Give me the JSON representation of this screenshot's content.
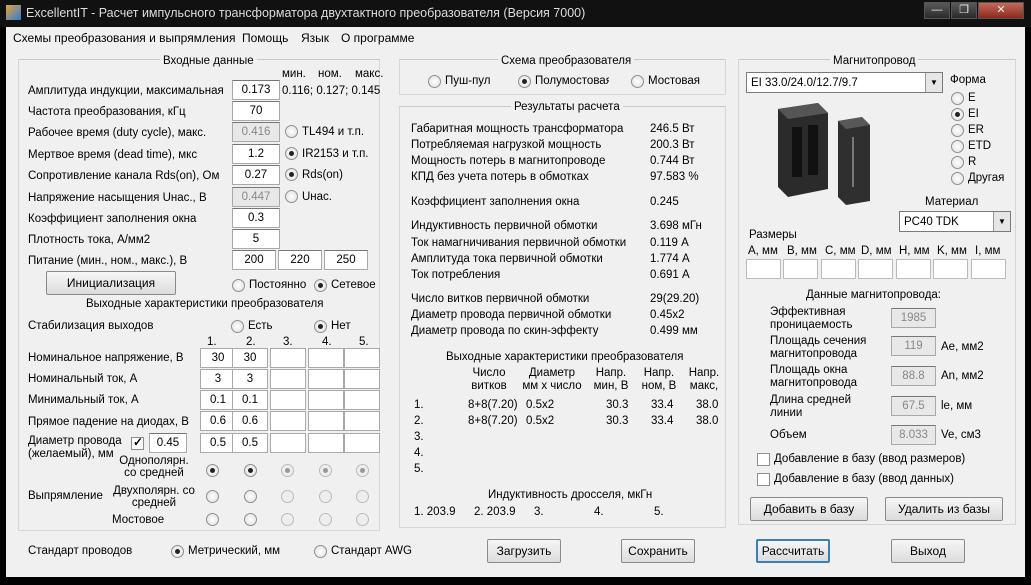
{
  "window": {
    "title": "ExcellentIT - Расчет импульсного трансформатора двухтактного преобразователя (Версия 7000)",
    "min": "—",
    "max": "❐",
    "close": "✕"
  },
  "menu": [
    "Схемы преобразования и выпрямления",
    "Помощь",
    "Язык",
    "О программе"
  ],
  "input": {
    "title": "Входные данные",
    "col_min": "мин.",
    "col_nom": "ном.",
    "col_max": "макс.",
    "induction_label": "Амплитуда индукции, максимальная",
    "induction_value": "0.173",
    "induction_hint": "0.116; 0.127; 0.145",
    "freq_label": "Частота преобразования, кГц",
    "freq_value": "70",
    "duty_label": "Рабочее время (duty cycle), макс.",
    "duty_value": "0.416",
    "duty_opt": "TL494 и т.п.",
    "dead_label": "Мертвое время (dead time), мкс",
    "dead_value": "1.2",
    "dead_opt": "IR2153 и т.п.",
    "rds_label": "Сопротивление канала Rds(on), Ом",
    "rds_value": "0.27",
    "rds_opt": "Rds(on)",
    "usat_label": "Напряжение насыщения Uнас., В",
    "usat_value": "0.447",
    "usat_opt": "Uнас.",
    "fill_label": "Коэффициент заполнения окна",
    "fill_value": "0.3",
    "density_label": "Плотность тока, А/мм2",
    "density_value": "5",
    "supply_label": "Питание (мин., ном., макс.), В",
    "supply_min": "200",
    "supply_nom": "220",
    "supply_max": "250",
    "init_button": "Инициализация",
    "const_label": "Постоянно",
    "mains_label": "Сетевое"
  },
  "outputs": {
    "title": "Выходные характеристики преобразователя",
    "stab_label": "Стабилизация выходов",
    "yes": "Есть",
    "no": "Нет",
    "cols": [
      "1.",
      "2.",
      "3.",
      "4.",
      "5."
    ],
    "vnom_label": "Номинальное напряжение, В",
    "vnom": [
      "30",
      "30",
      "",
      "",
      ""
    ],
    "inom_label": "Номинальный ток, А",
    "inom": [
      "3",
      "3",
      "",
      "",
      ""
    ],
    "imin_label": "Минимальный ток, А",
    "imin": [
      "0.1",
      "0.1",
      "",
      "",
      ""
    ],
    "vdiode_label": "Прямое падение на диодах, В",
    "vdiode": [
      "0.6",
      "0.6",
      "",
      "",
      ""
    ],
    "wire_label": "Диаметр провода (желаемый), мм",
    "wire_default": "0.45",
    "wire": [
      "0.5",
      "0.5",
      "",
      "",
      ""
    ],
    "rect_label": "Выпрямление",
    "rect_opts": [
      "Однополярн. со средней",
      "Двухполярн. со средней",
      "Мостовое"
    ]
  },
  "wire_std": {
    "label": "Стандарт проводов",
    "metric": "Метрический, мм",
    "awg": "Стандарт AWG"
  },
  "scheme": {
    "title": "Схема преобразователя",
    "opts": [
      "Пуш-пул",
      "Полумостовая",
      "Мостовая"
    ]
  },
  "results": {
    "title": "Результаты расчета",
    "rows": [
      [
        "Габаритная мощность трансформатора",
        "246.5 Вт"
      ],
      [
        "Потребляемая нагрузкой мощность",
        "200.3 Вт"
      ],
      [
        "Мощность потерь в магнитопроводе",
        "0.744 Вт"
      ],
      [
        "КПД без учета потерь в обмотках",
        "97.583 %"
      ],
      [
        "Коэффициент заполнения окна",
        "0.245"
      ],
      [
        "Индуктивность первичной обмотки",
        "3.698 мГн"
      ],
      [
        "Ток намагничивания первичной обмотки",
        "0.119 А"
      ],
      [
        "Амплитуда тока первичной обмотки",
        "1.774 А"
      ],
      [
        "Ток потребления",
        "0.691 А"
      ],
      [
        "Число витков первичной обмотки",
        "29(29.20)"
      ],
      [
        "Диаметр провода первичной обмотки",
        "0.45x2"
      ],
      [
        "Диаметр провода по скин-эффекту",
        "0.499 мм"
      ]
    ],
    "out_title": "Выходные характеристики преобразователя",
    "h_turns": "Число витков",
    "h_diam": "Диаметр мм х число",
    "h_vmin": "Напр. мин, В",
    "h_vnom": "Напр. ном, В",
    "h_vmax": "Напр. макс,",
    "out_rows": [
      [
        "1.",
        "8+8(7.20)",
        "0.5x2",
        "30.3",
        "33.4",
        "38.0"
      ],
      [
        "2.",
        "8+8(7.20)",
        "0.5x2",
        "30.3",
        "33.4",
        "38.0"
      ],
      [
        "3.",
        "",
        "",
        "",
        "",
        ""
      ],
      [
        "4.",
        "",
        "",
        "",
        "",
        ""
      ],
      [
        "5.",
        "",
        "",
        "",
        "",
        ""
      ]
    ],
    "choke_title": "Индуктивность дросселя, мкГн",
    "choke": [
      "1. 203.9",
      "2. 203.9",
      "3.",
      "4.",
      "5."
    ]
  },
  "core": {
    "title": "Магнитопровод",
    "selected": "EI 33.0/24.0/12.7/9.7",
    "shape_label": "Форма",
    "shapes": [
      "E",
      "EI",
      "ER",
      "ETD",
      "R",
      "Другая"
    ],
    "material_label": "Материал",
    "material": "PC40 TDK",
    "dims_label": "Размеры",
    "dims": [
      "A, мм",
      "B, мм",
      "C, мм",
      "D, мм",
      "H, мм",
      "K, мм",
      "I, мм"
    ],
    "data_title": "Данные магнитопровода:",
    "perm_label": "Эффективная проницаемость",
    "perm": "1985",
    "ae_label": "Площадь сечения магнитопровода",
    "ae": "119",
    "ae_unit": "Ae, мм2",
    "an_label": "Площадь окна магнитопровода",
    "an": "88.8",
    "an_unit": "An, мм2",
    "le_label": "Длина средней линии",
    "le": "67.5",
    "le_unit": "le, мм",
    "ve_label": "Объем",
    "ve": "8.033",
    "ve_unit": "Ve, см3",
    "add_dims": "Добавление в базу (ввод размеров)",
    "add_data": "Добавление в базу (ввод данных)",
    "add_btn": "Добавить в базу",
    "del_btn": "Удалить из базы"
  },
  "buttons": {
    "load": "Загрузить",
    "save": "Сохранить",
    "calc": "Рассчитать",
    "exit": "Выход"
  }
}
